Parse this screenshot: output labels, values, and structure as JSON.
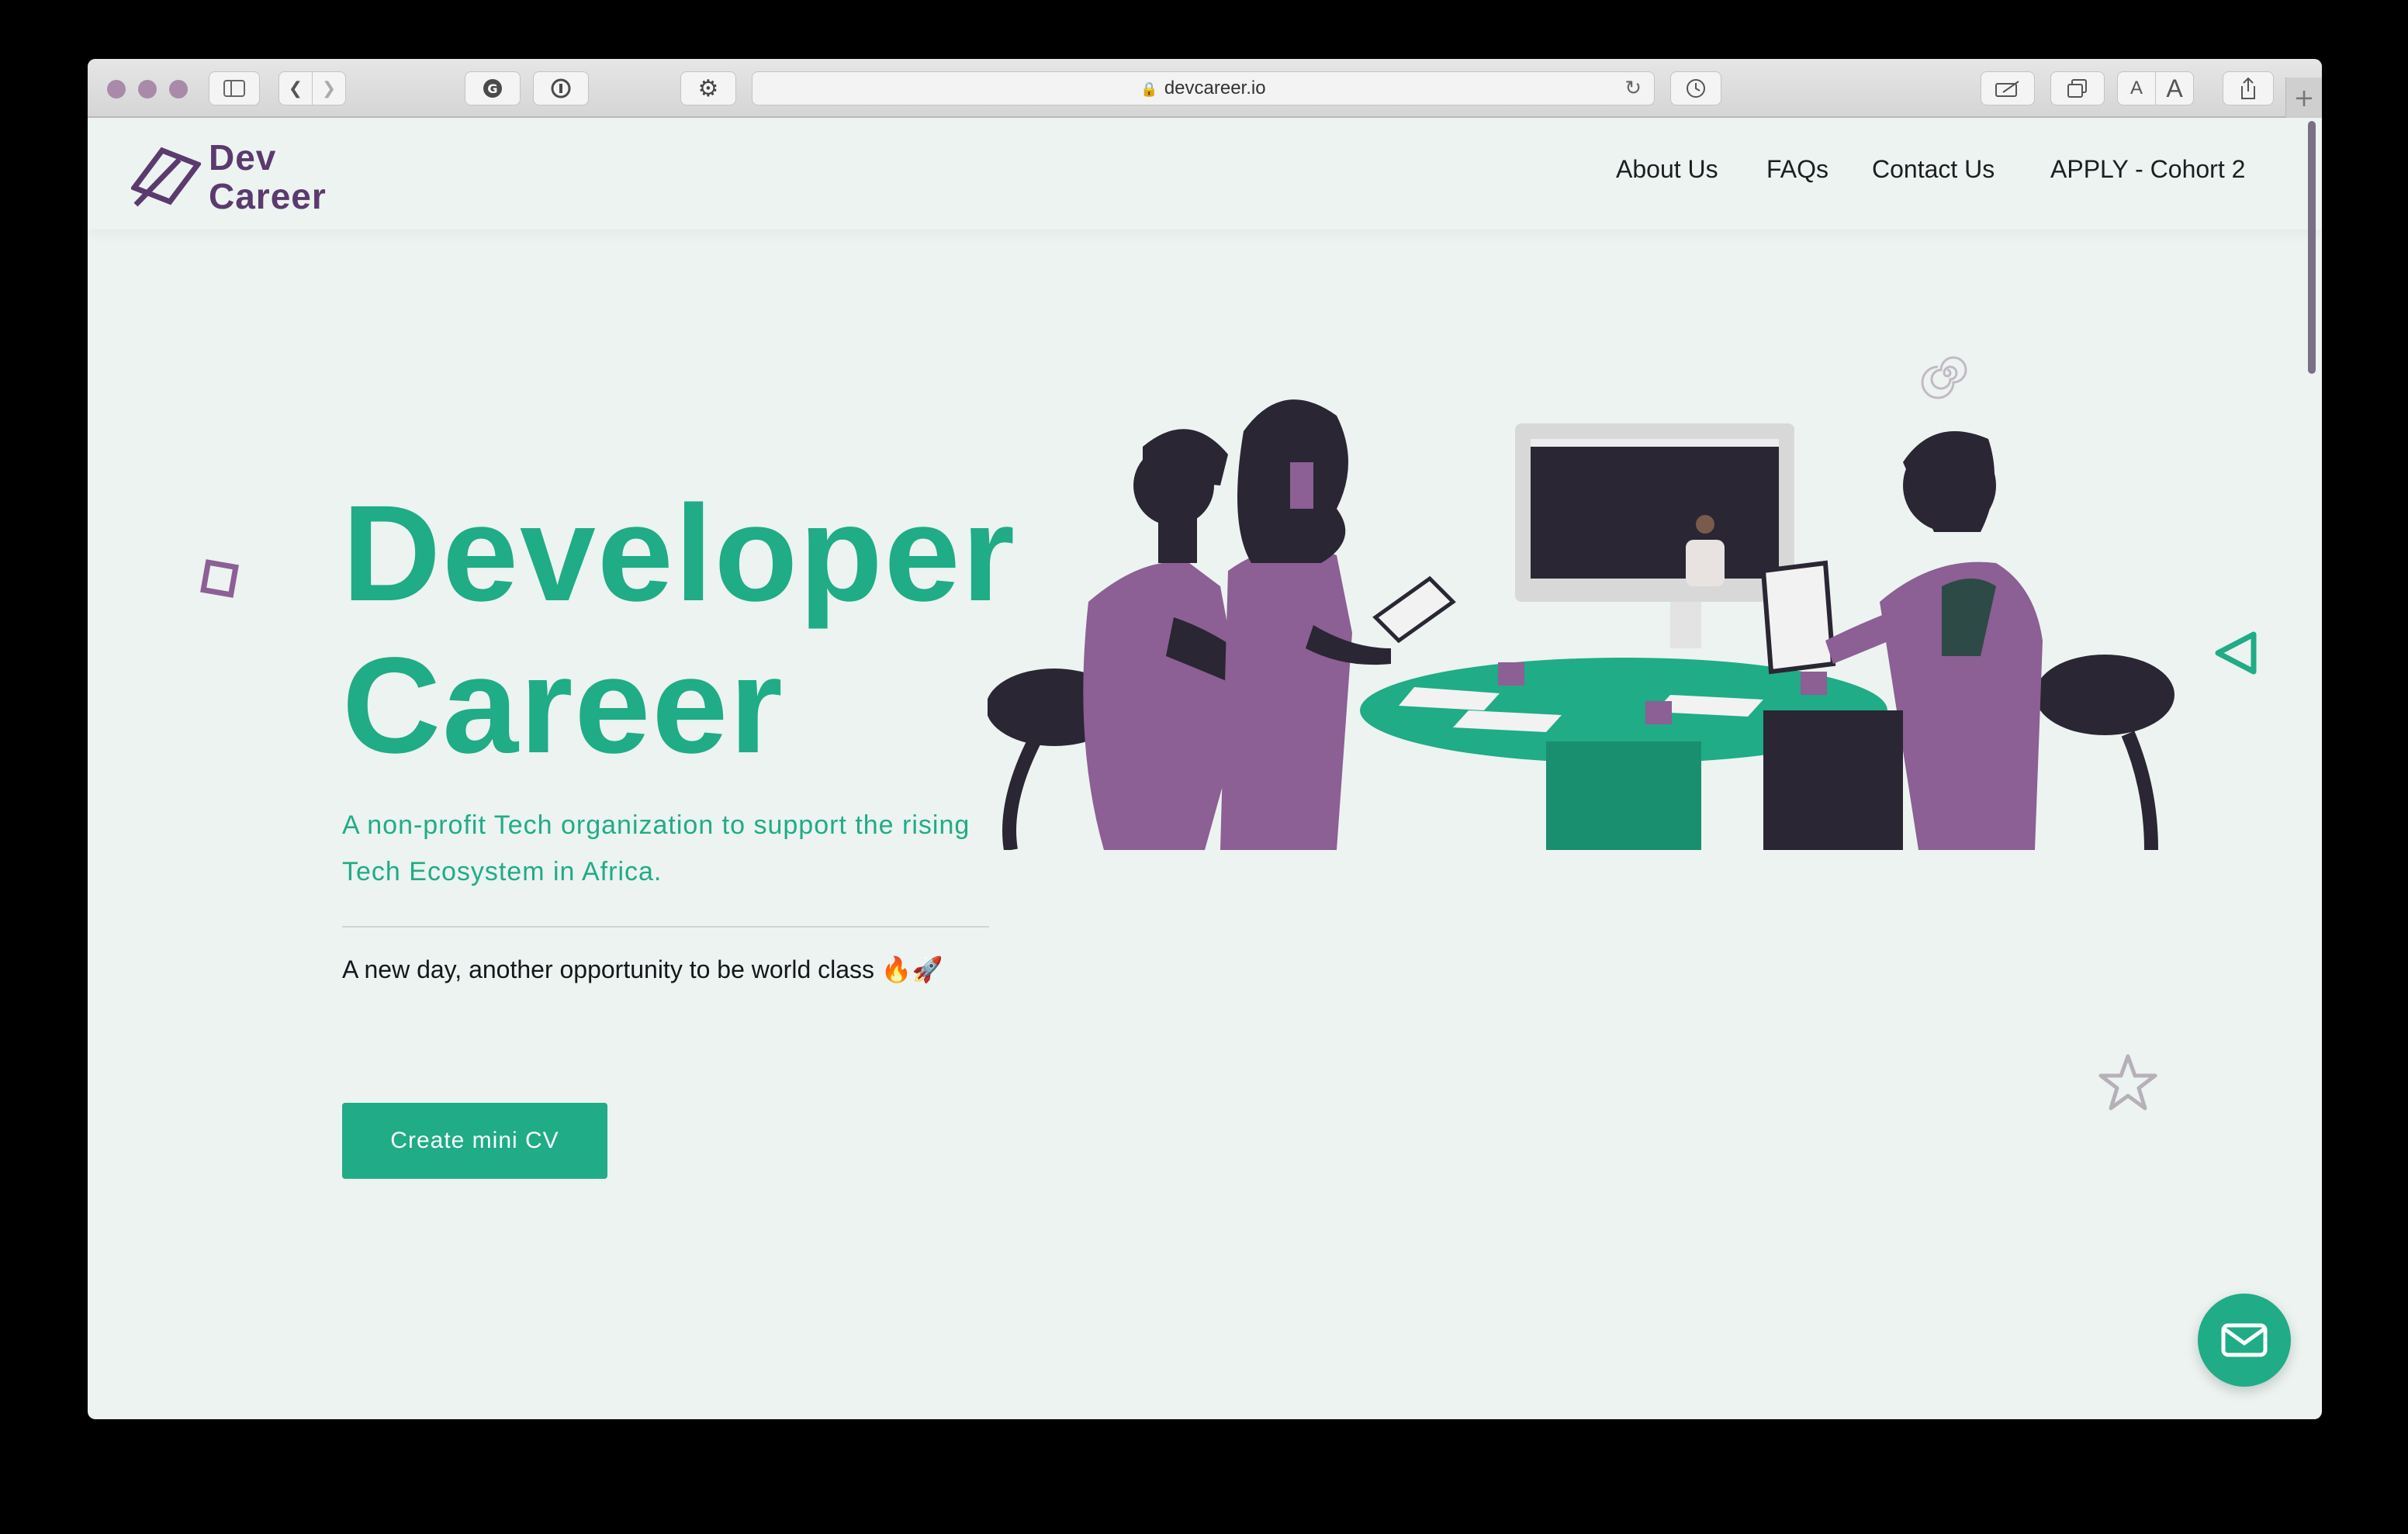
{
  "browser": {
    "url": "devcareer.io",
    "zoom_small": "A",
    "zoom_large": "A"
  },
  "site": {
    "logo_line1": "Dev",
    "logo_line2": "Career"
  },
  "nav": {
    "items": [
      "About Us",
      "FAQs",
      "Contact Us",
      "APPLY - Cohort 2"
    ]
  },
  "hero": {
    "title_line1": "Developer",
    "title_line2": "Career",
    "subtitle": "A non-profit Tech organization to support the rising Tech Ecosystem in Africa.",
    "tagline": "A new day, another opportunity to be world class 🔥🚀",
    "cta_label": "Create mini CV"
  },
  "colors": {
    "brand_green": "#1fac87",
    "brand_purple": "#5b3a6e",
    "background": "#ecf3f0"
  },
  "icons": {
    "mail": "envelope-icon",
    "lock": "lock-icon"
  }
}
